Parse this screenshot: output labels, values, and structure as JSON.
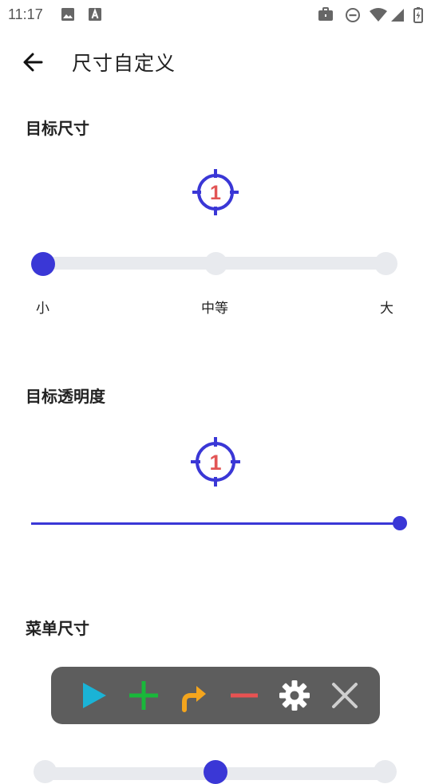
{
  "status_bar": {
    "time": "11:17",
    "left_icons": [
      "image-icon",
      "font-icon"
    ],
    "right_icons": [
      "briefcase-icon",
      "do-not-disturb-icon",
      "wifi-icon",
      "signal-icon",
      "battery-charging-icon"
    ]
  },
  "toolbar": {
    "title": "尺寸自定义",
    "back_icon": "arrow-left-icon"
  },
  "target_size": {
    "title": "目标尺寸",
    "target_number": "1",
    "options": [
      "小",
      "中等",
      "大"
    ],
    "selected_index": 0
  },
  "target_opacity": {
    "title": "目标透明度",
    "target_number": "1",
    "value_fraction": 1.0
  },
  "menu_size": {
    "title": "菜单尺寸",
    "selected_index": 1
  },
  "floating_menu": {
    "buttons": [
      {
        "name": "play-icon",
        "color": "#1ab3d6"
      },
      {
        "name": "plus-icon",
        "color": "#19b83a"
      },
      {
        "name": "swipe-arrow-icon",
        "color": "#f4a51d"
      },
      {
        "name": "minus-icon",
        "color": "#e85252"
      },
      {
        "name": "gear-icon",
        "color": "#ffffff"
      },
      {
        "name": "close-icon",
        "color": "#cfcfcf"
      }
    ]
  },
  "colors": {
    "accent": "#3a37d6",
    "target_number": "#e25555",
    "track": "#e8eaee",
    "menu_bg": "#5d5d5d"
  }
}
